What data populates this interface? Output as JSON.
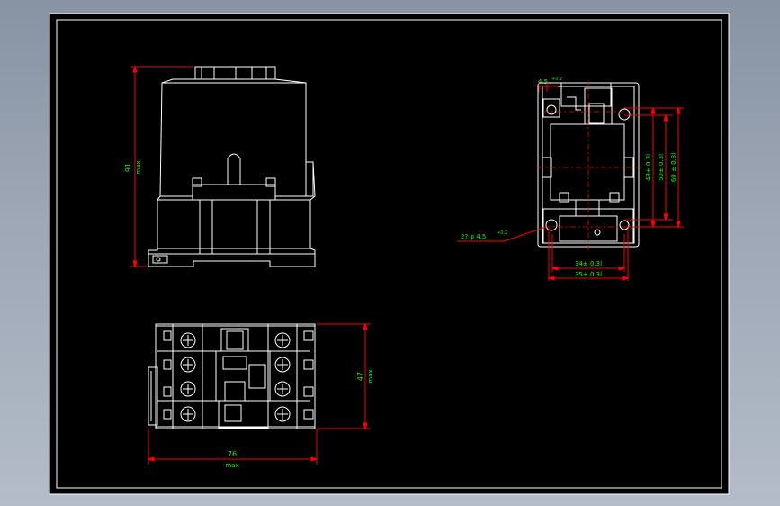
{
  "viewport": {
    "background_colors": [
      "#8893a3",
      "#b3bcc8"
    ]
  },
  "drawing": {
    "background_color": "#000000",
    "line_color": "#ffffff",
    "dimension_color": "#ff0000",
    "text_color": "#00ff00",
    "side_view": {
      "height_value": "91",
      "height_note": "max"
    },
    "top_view": {
      "width_value": "76",
      "width_note": "max",
      "depth_value": "47",
      "depth_note": "max"
    },
    "mount_view": {
      "top_dim": "4.5",
      "top_tol": "+0.2",
      "hole_label": "2? φ 4.5",
      "hole_tol": "+0.2",
      "dim_48": "48± 0.3l",
      "dim_50": "50± 0.3l",
      "dim_60": "60 ± 0.3l",
      "dim_34": "34± 0.3l",
      "dim_35": "35± 0.3l"
    }
  }
}
